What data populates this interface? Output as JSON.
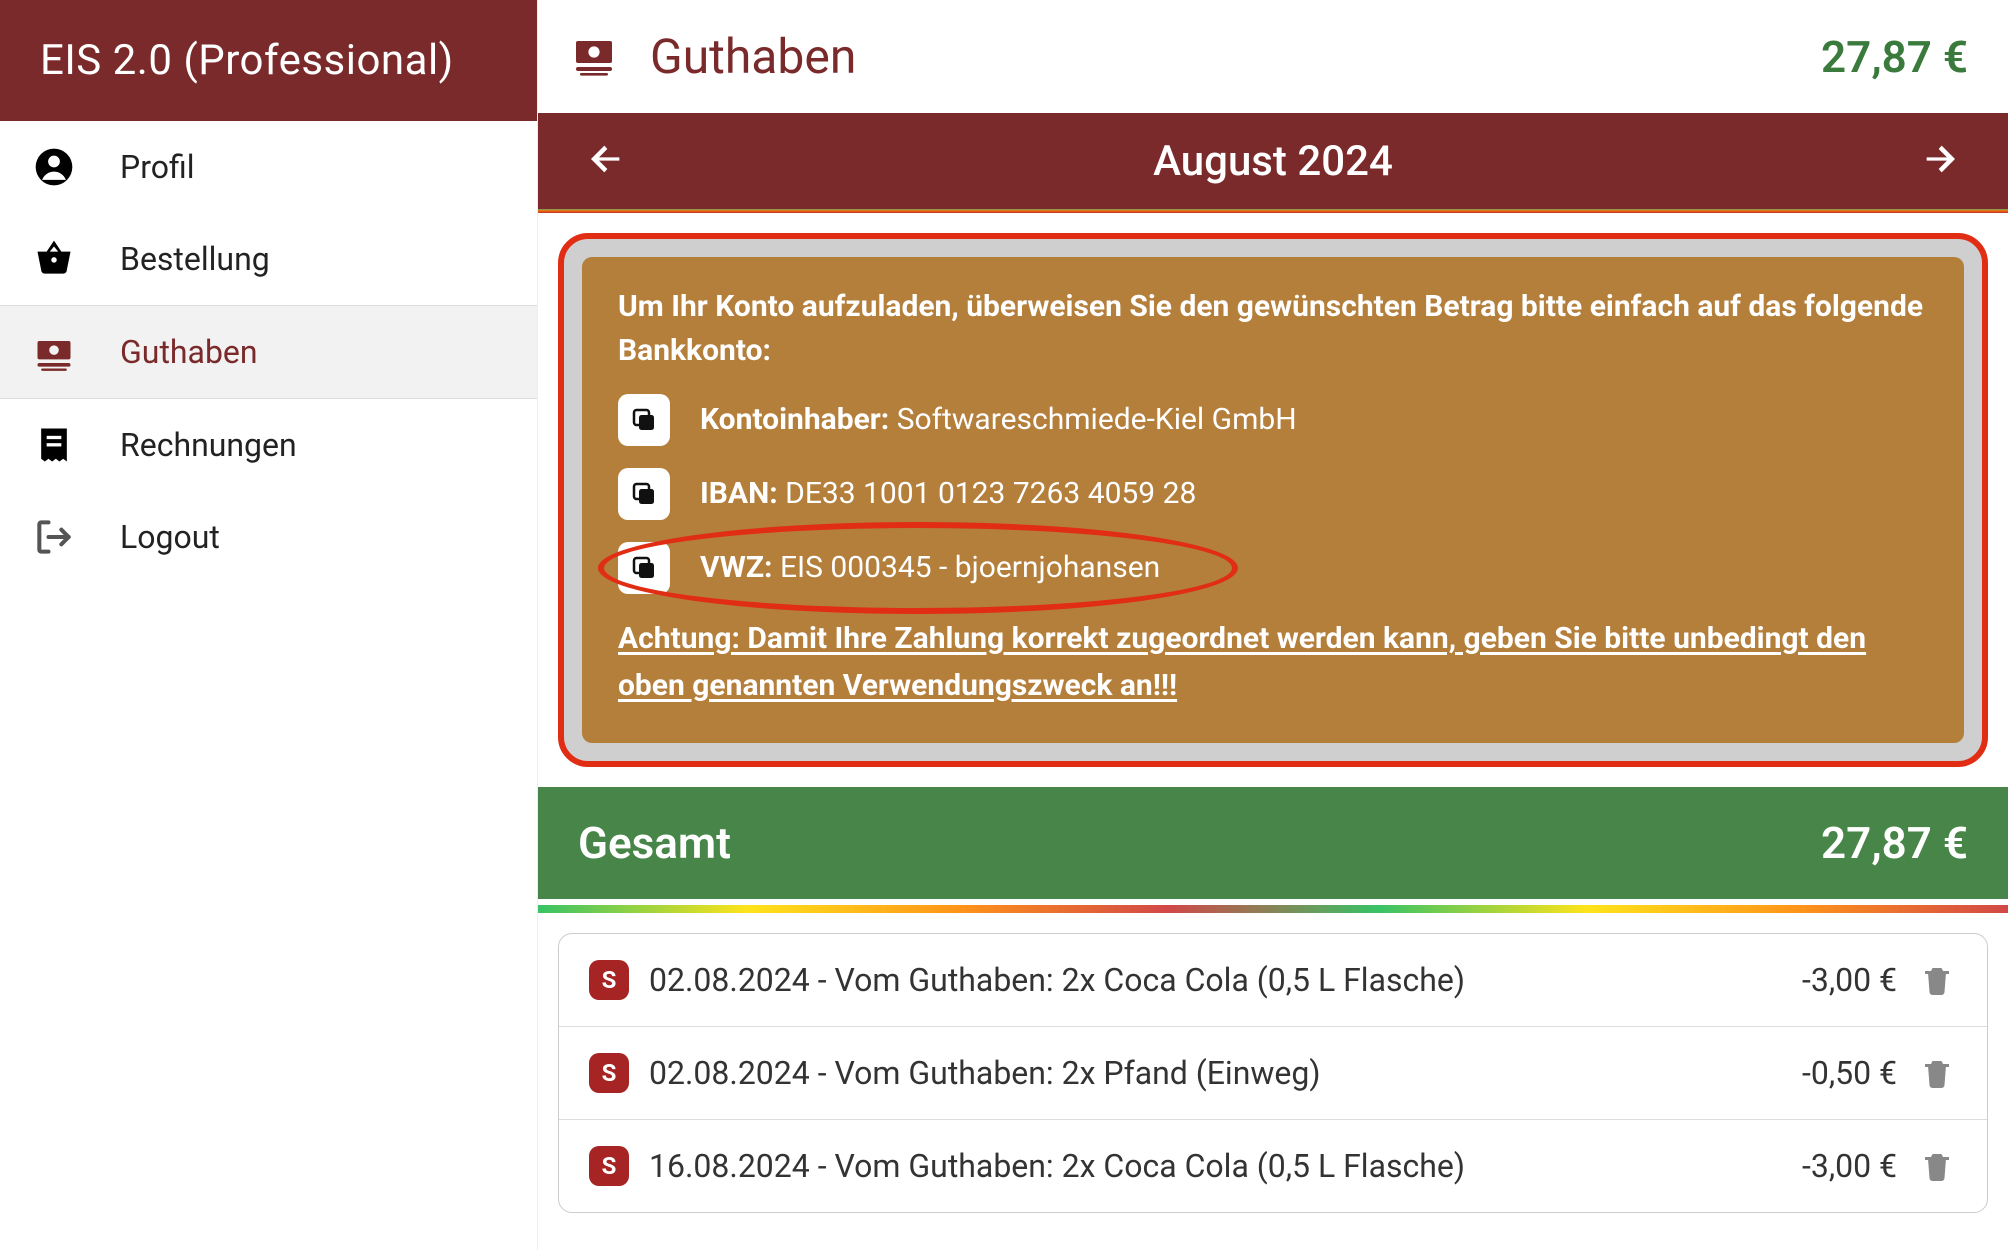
{
  "app": {
    "title": "EIS 2.0 (Professional)"
  },
  "sidebar": {
    "items": [
      {
        "label": "Profil"
      },
      {
        "label": "Bestellung"
      },
      {
        "label": "Guthaben"
      },
      {
        "label": "Rechnungen"
      },
      {
        "label": "Logout"
      }
    ]
  },
  "header": {
    "title": "Guthaben",
    "balance": "27,87 €"
  },
  "month": {
    "label": "August 2024"
  },
  "info": {
    "intro": "Um Ihr Konto aufzuladen, überweisen Sie den gewünschten Betrag bitte einfach auf das folgende Bankkonto:",
    "owner_label": "Kontoinhaber:",
    "owner_value": "Softwareschmiede-Kiel GmbH",
    "iban_label": "IBAN:",
    "iban_value": "DE33 1001 0123 7263 4059 28",
    "vwz_label": "VWZ:",
    "vwz_value": "EIS 000345 - bjoernjohansen",
    "warning": "Achtung: Damit Ihre Zahlung korrekt zugeordnet werden kann, geben Sie bitte unbedingt den oben genannten Verwendungszweck an!!!"
  },
  "total": {
    "label": "Gesamt",
    "value": "27,87 €"
  },
  "tx": {
    "badge": "S",
    "items": [
      {
        "text": "02.08.2024 - Vom Guthaben: 2x Coca Cola (0,5 L Flasche)",
        "amount": "-3,00 €"
      },
      {
        "text": "02.08.2024 - Vom Guthaben: 2x Pfand (Einweg)",
        "amount": "-0,50 €"
      },
      {
        "text": "16.08.2024 - Vom Guthaben: 2x Coca Cola (0,5 L Flasche)",
        "amount": "-3,00 €"
      }
    ]
  }
}
